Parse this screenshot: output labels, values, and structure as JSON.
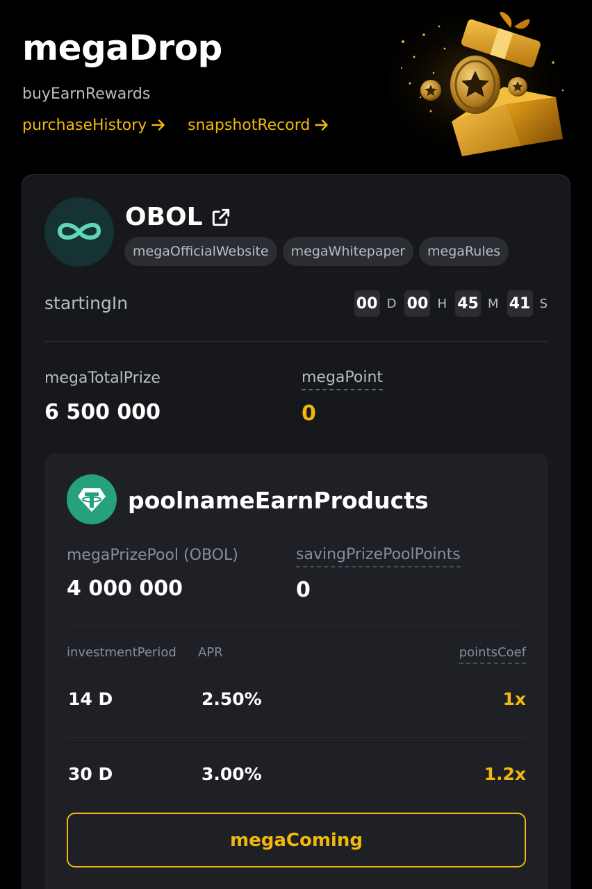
{
  "header": {
    "title": "megaDrop",
    "subtitle": "buyEarnRewards",
    "links": {
      "purchase_history": "purchaseHistory",
      "snapshot_record": "snapshotRecord"
    }
  },
  "project": {
    "token": "OBOL",
    "chips": {
      "website": "megaOfficialWebsite",
      "whitepaper": "megaWhitepaper",
      "rules": "megaRules"
    },
    "starting_label": "startingIn",
    "countdown": {
      "days": "00",
      "days_unit": "D",
      "hours": "00",
      "hours_unit": "H",
      "minutes": "45",
      "minutes_unit": "M",
      "seconds": "41",
      "seconds_unit": "S"
    },
    "total_prize_label": "megaTotalPrize",
    "total_prize_value": "6 500 000",
    "mega_point_label": "megaPoint",
    "mega_point_value": "0"
  },
  "pool": {
    "name": "poolnameEarnProducts",
    "prize_pool_label": "megaPrizePool (OBOL)",
    "prize_pool_value": "4 000 000",
    "points_label": "savingPrizePoolPoints",
    "points_value": "0",
    "table": {
      "headers": {
        "period": "investmentPeriod",
        "apr": "APR",
        "coef": "pointsCoef"
      },
      "rows": [
        {
          "period": "14 D",
          "apr": "2.50%",
          "coef": "1x"
        },
        {
          "period": "30 D",
          "apr": "3.00%",
          "coef": "1.2x"
        }
      ]
    },
    "button_label": "megaComing"
  },
  "colors": {
    "accent": "#F0B90B",
    "background": "#000000",
    "card": "#17181C",
    "inner_card": "#1E2026",
    "obol_teal": "#5FD6B8",
    "tether_green": "#26A17B"
  }
}
